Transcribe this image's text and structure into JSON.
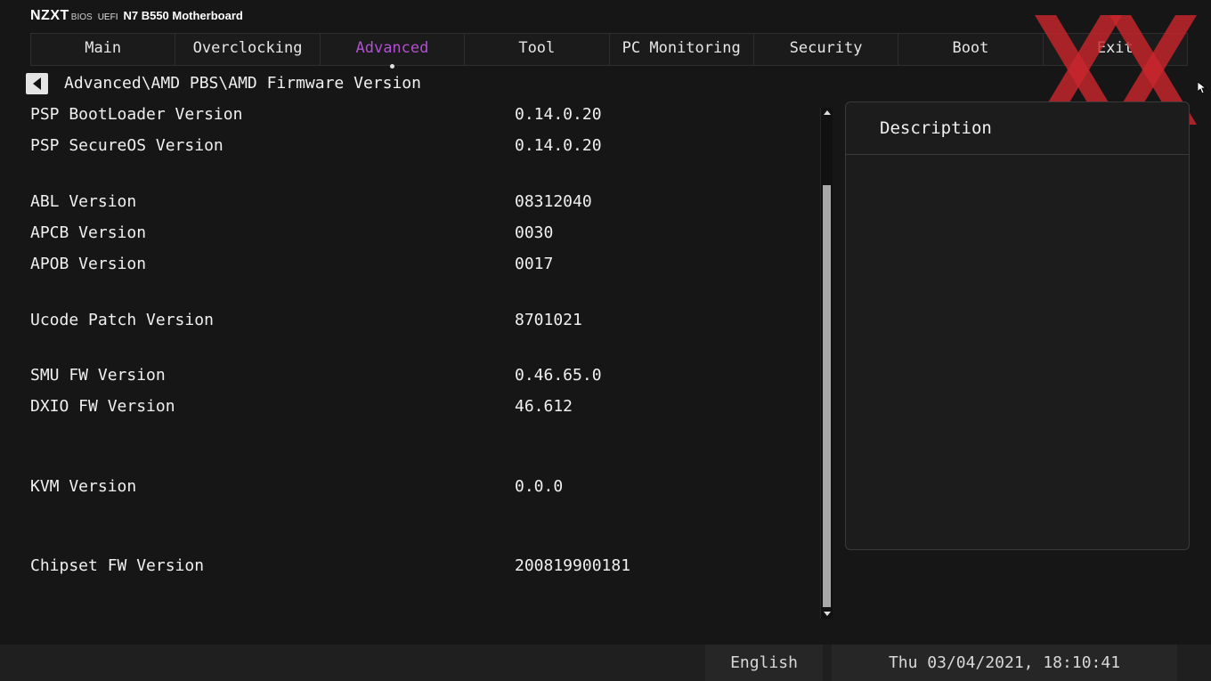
{
  "header": {
    "brand": "NZXT",
    "bios": "BIOS",
    "uefi": "UEFI",
    "board": "N7 B550 Motherboard"
  },
  "nav": {
    "tabs": [
      {
        "label": "Main",
        "active": false
      },
      {
        "label": "Overclocking",
        "active": false
      },
      {
        "label": "Advanced",
        "active": true
      },
      {
        "label": "Tool",
        "active": false
      },
      {
        "label": "PC Monitoring",
        "active": false
      },
      {
        "label": "Security",
        "active": false
      },
      {
        "label": "Boot",
        "active": false
      },
      {
        "label": "Exit",
        "active": false
      }
    ]
  },
  "breadcrumb": "Advanced\\AMD PBS\\AMD Firmware Version",
  "rows": [
    {
      "label": "PSP BootLoader Version",
      "value": "0.14.0.20"
    },
    {
      "label": "PSP SecureOS Version",
      "value": "0.14.0.20"
    },
    {
      "label": "ABL Version",
      "value": "08312040"
    },
    {
      "label": "APCB Version",
      "value": "0030"
    },
    {
      "label": "APOB Version",
      "value": "0017"
    },
    {
      "label": "Ucode Patch Version",
      "value": "8701021"
    },
    {
      "label": "SMU FW Version",
      "value": "0.46.65.0"
    },
    {
      "label": "DXIO FW Version",
      "value": "46.612"
    },
    {
      "label": "KVM Version",
      "value": "0.0.0"
    },
    {
      "label": "Chipset FW Version",
      "value": "200819900181"
    }
  ],
  "description": {
    "heading": "Description"
  },
  "footer": {
    "language": "English",
    "datetime": "Thu 03/04/2021, 18:10:41"
  },
  "colors": {
    "accent": "#b24fd0",
    "background": "#161616",
    "watermark": "#c8262c"
  },
  "icons": {
    "back": "back-arrow-icon",
    "scroll_up": "scroll-up-icon",
    "scroll_down": "scroll-down-icon",
    "cursor": "mouse-pointer-icon",
    "watermark": "xx-logo-watermark"
  }
}
